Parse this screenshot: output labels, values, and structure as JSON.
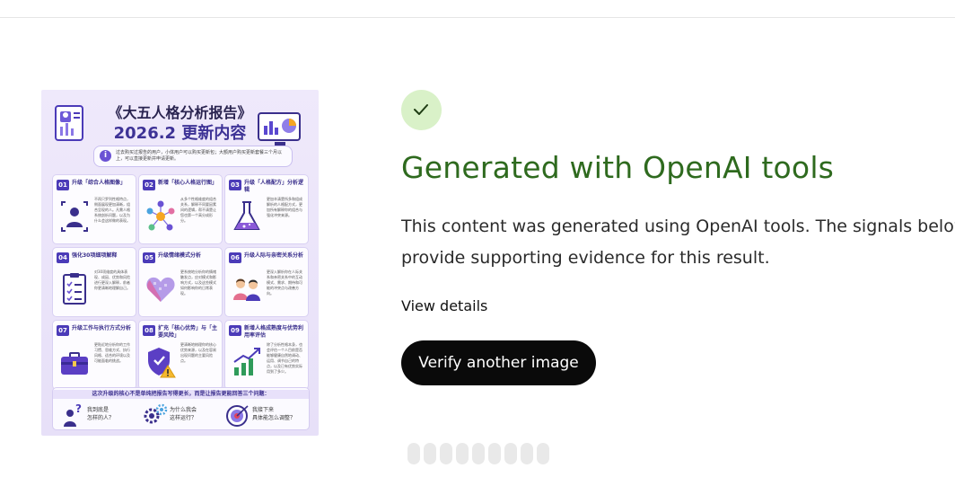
{
  "poster": {
    "title": "《大五人格分析报告》",
    "subtitle": "2026.2 更新内容",
    "note": "过去购买过报告的用户，小体用户可以购买更新包；大额用户购买更新套餐三个月以上，可以直接更新并申请更新。",
    "cards": [
      {
        "num": "01",
        "title": "升级「综合人格图像」",
        "text": "不再只罗列性格特点，侧面展现更加清晰，组合呈现的人。凡需人格系统剖析问题，以及为什么会这样做的表现。",
        "icon": "person-scan-icon"
      },
      {
        "num": "02",
        "title": "新增「核心人格运行图」",
        "text": "从多个性格维度的组合关系，解释不同要因素间的逻辑，帮不清楚让您也第一个高分成形分。",
        "icon": "network-icon"
      },
      {
        "num": "03",
        "title": "升级「人格配方」分析逻辑",
        "text": "更加辛清楚所多和组成解析的人格配方式，更加所有解释你的组合与强化冲突来源。",
        "icon": "flask-icon"
      },
      {
        "num": "04",
        "title": "强化30项细项解释",
        "text": "对30项维度的具体表现、成因、优势和风险进行更深入解释，前者你更清晰地理解自己。",
        "icon": "checklist-icon"
      },
      {
        "num": "05",
        "title": "升级情绪模式分析",
        "text": "更系统地分析你的情绪触发点，应对模式和影响方式，以及这些模式如何影响你的日常表现。",
        "icon": "pixel-heart-icon"
      },
      {
        "num": "06",
        "title": "升级人际与亲密关系分析",
        "text": "更深入解析你在人际关系和亲密关系中的互动模式、需求、期待和可能的冲突点与改善方向。",
        "icon": "people-icon"
      },
      {
        "num": "07",
        "title": "升级工作与执行方式分析",
        "text": "更贴近地分析你的工作习惯、思维方式、执行风格、适合的环境以及可能面临的挑战。",
        "icon": "briefcase-icon"
      },
      {
        "num": "08",
        "title": "扩充「核心优势」与「主要风险」",
        "text": "更清晰地梳理你的核心优势来源，以及在容易出现问题的主要风险点。",
        "icon": "shield-warning-icon"
      },
      {
        "num": "09",
        "title": "新增人格成熟度与优势利用率评估",
        "text": "除了分析性格本身，也会评估一个人目前是否能够健康自然地调动、运用、调节自己的特点，以及已有优势实际用到了多少。",
        "icon": "growth-chart-icon"
      }
    ],
    "bottom_heading": "这次升级的核心不是单纯把报告写得更长，而是让报告更能回答三个问题：",
    "questions": [
      {
        "text": "我到底是\n怎样的人？",
        "icon": "question-person-icon"
      },
      {
        "text": "为什么我会\n这样运行？",
        "icon": "gears-icon"
      },
      {
        "text": "我接下来\n具体能怎么调整？",
        "icon": "target-icon"
      }
    ]
  },
  "result": {
    "heading": "Generated with OpenAI tools",
    "description": "This content was generated using OpenAI tools. The signals below provide supporting evidence for this result.",
    "details_link": "View details",
    "verify_button": "Verify another image"
  },
  "colors": {
    "heading_green": "#2e6a1e",
    "check_bg": "#d9f1c8",
    "button_bg": "#0a0a0a",
    "poster_accent": "#4b3bb8"
  }
}
